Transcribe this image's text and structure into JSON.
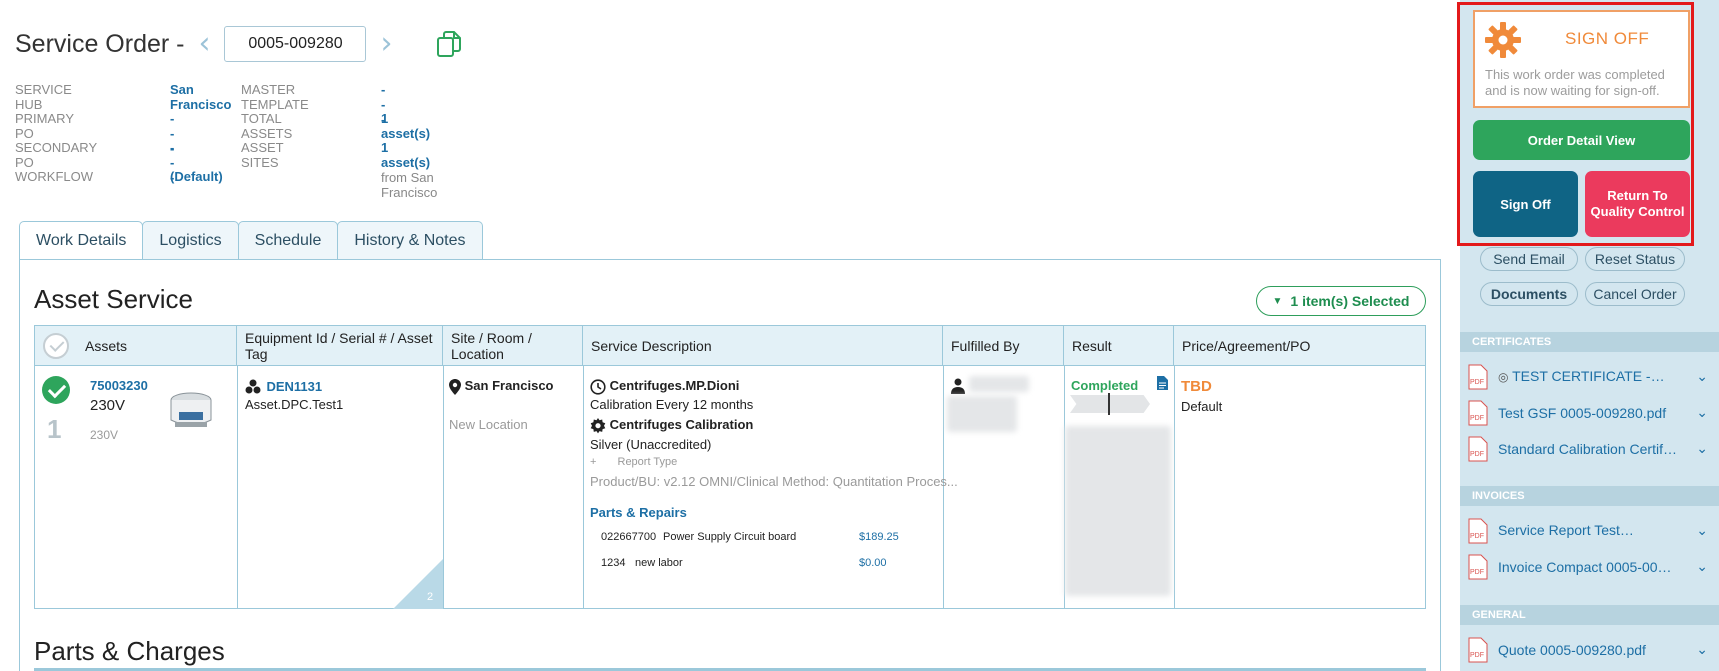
{
  "header": {
    "title": "Service Order -",
    "order_number": "0005-009280",
    "prev_arrow": "‹",
    "next_arrow": "›"
  },
  "meta": {
    "service_hub_label": "SERVICE HUB",
    "service_hub_value": "San Francisco",
    "master_template_label": "MASTER TEMPLATE",
    "master_template_value": "---",
    "primary_po_label": "PRIMARY PO",
    "primary_po_value": "---",
    "total_assets_label": "TOTAL ASSETS",
    "total_assets_value": "1 asset(s)",
    "secondary_po_label": "SECONDARY PO",
    "secondary_po_value": "---",
    "asset_sites_label": "ASSET SITES",
    "asset_sites_value": "1 asset(s)",
    "asset_sites_extra": "from San Francisco",
    "workflow_label": "WORKFLOW",
    "workflow_value": "(Default)"
  },
  "tabs": [
    "Work Details",
    "Logistics",
    "Schedule",
    "History & Notes"
  ],
  "asset_service": {
    "title": "Asset Service",
    "selected_label": "1 item(s) Selected",
    "columns": [
      "Assets",
      "Equipment Id / Serial # / Asset Tag",
      "Site / Room / Location",
      "Service Description",
      "Fulfilled By",
      "Result",
      "Price/Agreement/PO"
    ],
    "row": {
      "index": "1",
      "asset_id": "75003230",
      "asset_voltage": "230V",
      "asset_voltage_small": "230V",
      "equipment_id": "DEN1131",
      "equipment_tag": "Asset.DPC.Test1",
      "corner_count": "2",
      "site": "San Francisco",
      "location": "New Location",
      "service_name": "Centrifuges.MP.Dioni",
      "service_freq": "Calibration Every 12 months",
      "calibration": "Centrifuges Calibration",
      "calibration_level": "Silver (Unaccredited)",
      "report_plus": "+",
      "report_type": "Report Type",
      "product_bu": "Product/BU: v2.12 OMNI/Clinical Method: Quantitation Proces...",
      "parts_title": "Parts & Repairs",
      "parts": [
        {
          "code": "022667700",
          "name": "Power Supply Circuit board",
          "price": "$189.25"
        },
        {
          "code": "1234",
          "name": "new labor",
          "price": "$0.00"
        }
      ],
      "result": "Completed",
      "price": "TBD",
      "agreement": "Default"
    }
  },
  "parts_charges_title": "Parts & Charges",
  "sidebar": {
    "sign_off_title": "SIGN OFF",
    "sign_off_text": "This work order was completed and is now waiting for sign-off.",
    "order_detail_view": "Order Detail View",
    "sign_off_button": "Sign Off",
    "return_qc": "Return To Quality Control",
    "send_email": "Send Email",
    "reset_status": "Reset Status",
    "documents": "Documents",
    "cancel_order": "Cancel Order",
    "sections": {
      "certificates": "CERTIFICATES",
      "invoices": "INVOICES",
      "general": "GENERAL"
    },
    "certificates": [
      "TEST CERTIFICATE -",
      "Test GSF 0005-009280.pdf",
      "Standard Calibration Certificate"
    ],
    "invoices": [
      "Service Report Test",
      "Invoice Compact 0005-009280"
    ],
    "general": [
      "Quote 0005-009280.pdf"
    ],
    "pdf_tag": "PDF"
  },
  "colors": {
    "brand_blue": "#1d6fa5",
    "success_green": "#2ea55c",
    "sign_off_orange": "#f08a3a",
    "danger_red": "#eb3a5d",
    "dark_blue": "#0f6485",
    "highlight_red": "#e3191b"
  }
}
